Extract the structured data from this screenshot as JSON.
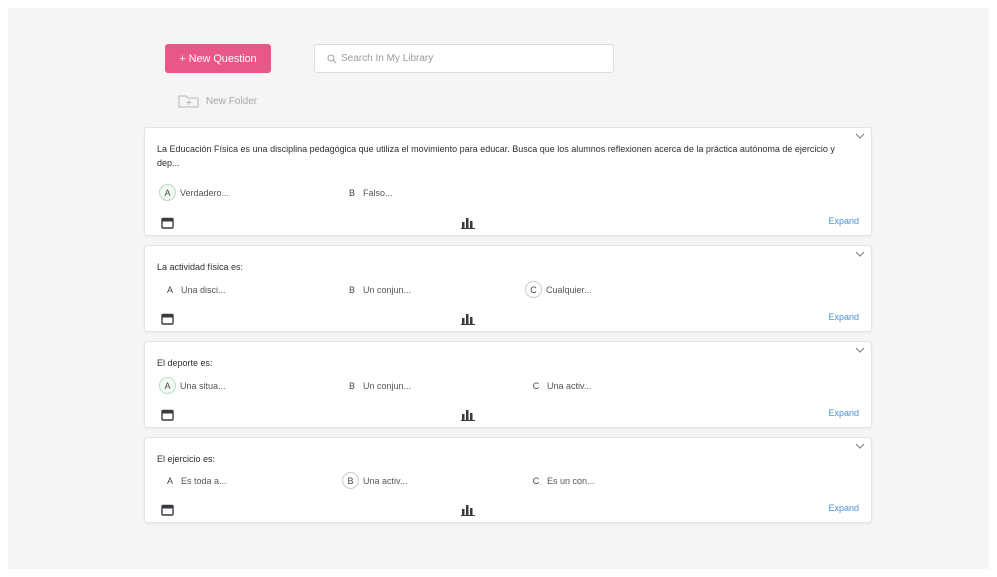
{
  "toolbar": {
    "new_question_label": "+ New Question",
    "search_placeholder": "Search In My Library",
    "new_folder_label": "New Folder"
  },
  "colors": {
    "accent": "#e8578a",
    "link": "#4a8ed8"
  },
  "questions": [
    {
      "text": "La Educación Física es una disciplina pedagógica que utiliza el movimiento para educar. Busca que los alumnos reflexionen acerca de la práctica autónoma de ejercicio y dep...",
      "answers": [
        {
          "letter": "A",
          "text": "Verdadero..."
        },
        {
          "letter": "B",
          "text": "Falso..."
        }
      ],
      "expand_label": "Expand"
    },
    {
      "text": "La actividad física es:",
      "answers": [
        {
          "letter": "A",
          "text": "Una disci..."
        },
        {
          "letter": "B",
          "text": "Un conjun..."
        },
        {
          "letter": "C",
          "text": "Cualquier..."
        }
      ],
      "expand_label": "Expand"
    },
    {
      "text": "El deporte es:",
      "answers": [
        {
          "letter": "A",
          "text": "Una situa..."
        },
        {
          "letter": "B",
          "text": "Un conjun..."
        },
        {
          "letter": "C",
          "text": "Una activ..."
        }
      ],
      "expand_label": "Expand"
    },
    {
      "text": "El ejercicio es:",
      "answers": [
        {
          "letter": "A",
          "text": "Es toda a..."
        },
        {
          "letter": "B",
          "text": "Una activ..."
        },
        {
          "letter": "C",
          "text": "Es un con..."
        }
      ],
      "expand_label": "Expand"
    }
  ]
}
